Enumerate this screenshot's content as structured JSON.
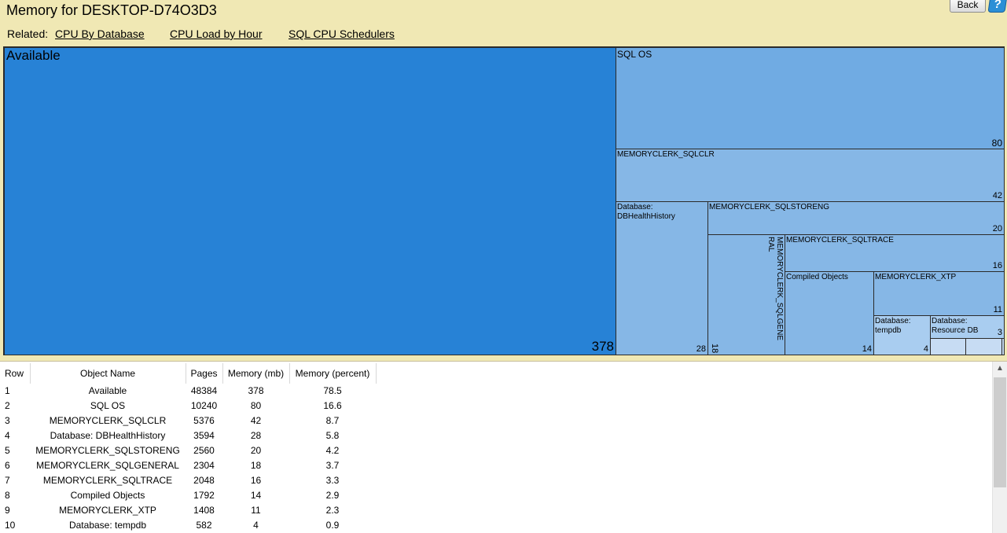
{
  "header": {
    "title": "Memory for DESKTOP-D74O3D3",
    "back_label": "Back",
    "help_glyph": "?",
    "help_icon": "help-icon"
  },
  "related": {
    "label": "Related:",
    "links": [
      "CPU By Database",
      "CPU Load by Hour",
      "SQL CPU Schedulers"
    ]
  },
  "treemap": {
    "available": {
      "name": "Available",
      "value": "378"
    },
    "sqlos": {
      "name": "SQL OS",
      "value": "80"
    },
    "sqlclr": {
      "name": "MEMORYCLERK_SQLCLR",
      "value": "42"
    },
    "dbhealth": {
      "name": "Database:\nDBHealthHistory",
      "value": "28"
    },
    "storeng": {
      "name": "MEMORYCLERK_SQLSTORENG",
      "value": "20"
    },
    "general": {
      "name": "MEMORYCLERK_SQLGENE\nRAL",
      "value": "18"
    },
    "trace": {
      "name": "MEMORYCLERK_SQLTRACE",
      "value": "16"
    },
    "compiled": {
      "name": "Compiled Objects",
      "value": "14"
    },
    "xtp": {
      "name": "MEMORYCLERK_XTP",
      "value": "11"
    },
    "tempdb": {
      "name": "Database:\ntempdb",
      "value": "4"
    },
    "resourcedb": {
      "name": "Database:\nResource DB",
      "value": "3"
    }
  },
  "table": {
    "columns": [
      "Row",
      "Object Name",
      "Pages",
      "Memory (mb)",
      "Memory (percent)"
    ],
    "rows": [
      [
        "1",
        "Available",
        "48384",
        "378",
        "78.5"
      ],
      [
        "2",
        "SQL OS",
        "10240",
        "80",
        "16.6"
      ],
      [
        "3",
        "MEMORYCLERK_SQLCLR",
        "5376",
        "42",
        "8.7"
      ],
      [
        "4",
        "Database: DBHealthHistory",
        "3594",
        "28",
        "5.8"
      ],
      [
        "5",
        "MEMORYCLERK_SQLSTORENG",
        "2560",
        "20",
        "4.2"
      ],
      [
        "6",
        "MEMORYCLERK_SQLGENERAL",
        "2304",
        "18",
        "3.7"
      ],
      [
        "7",
        "MEMORYCLERK_SQLTRACE",
        "2048",
        "16",
        "3.3"
      ],
      [
        "8",
        "Compiled Objects",
        "1792",
        "14",
        "2.9"
      ],
      [
        "9",
        "MEMORYCLERK_XTP",
        "1408",
        "11",
        "2.3"
      ],
      [
        "10",
        "Database: tempdb",
        "582",
        "4",
        "0.9"
      ]
    ]
  },
  "scrollbar": {
    "up_glyph": "▲"
  }
}
